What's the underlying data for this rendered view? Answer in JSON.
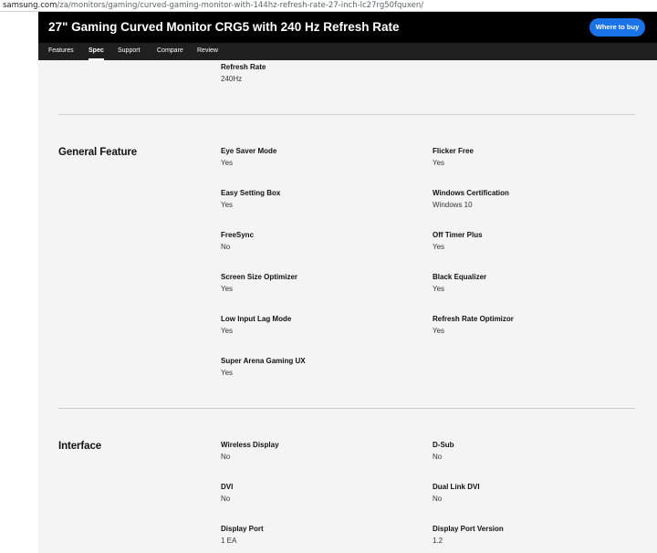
{
  "browser": {
    "url_host": "samsung.com",
    "url_path": "/za/monitors/gaming/curved-gaming-monitor-with-144hz-refresh-rate-27-inch-lc27rg50fquxen/"
  },
  "header": {
    "title": "27\" Gaming Curved Monitor CRG5 with 240 Hz Refresh Rate",
    "cta": "Where to buy",
    "tabs": [
      {
        "label": "Features"
      },
      {
        "label": "Spec"
      },
      {
        "label": "Support"
      },
      {
        "label": "Compare"
      },
      {
        "label": "Review"
      }
    ]
  },
  "top_spec": {
    "label": "Refresh Rate",
    "value": "240Hz"
  },
  "sections": [
    {
      "title": "General Feature",
      "items": [
        {
          "label": "Eye Saver Mode",
          "value": "Yes"
        },
        {
          "label": "Flicker Free",
          "value": "Yes"
        },
        {
          "label": "Easy Setting Box",
          "value": "Yes"
        },
        {
          "label": "Windows Certification",
          "value": "Windows 10"
        },
        {
          "label": "FreeSync",
          "value": "No"
        },
        {
          "label": "Off Timer Plus",
          "value": "Yes"
        },
        {
          "label": "Screen Size Optimizer",
          "value": "Yes"
        },
        {
          "label": "Black Equalizer",
          "value": "Yes"
        },
        {
          "label": "Low Input Lag Mode",
          "value": "Yes"
        },
        {
          "label": "Refresh Rate Optimizor",
          "value": "Yes"
        },
        {
          "label": "Super Arena Gaming UX",
          "value": "Yes"
        }
      ]
    },
    {
      "title": "Interface",
      "items": [
        {
          "label": "Wireless Display",
          "value": "No"
        },
        {
          "label": "D-Sub",
          "value": "No"
        },
        {
          "label": "DVI",
          "value": "No"
        },
        {
          "label": "Dual Link DVI",
          "value": "No"
        },
        {
          "label": "Display Port",
          "value": "1 EA"
        },
        {
          "label": "Display Port Version",
          "value": "1.2"
        }
      ]
    }
  ]
}
